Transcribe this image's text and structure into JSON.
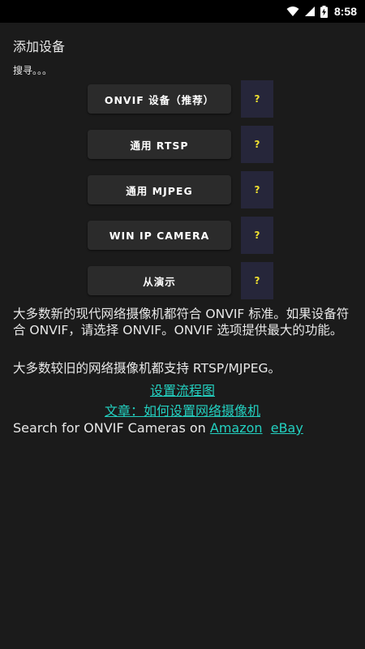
{
  "status_bar": {
    "time": "8:58",
    "icons": [
      "wifi-icon",
      "signal-icon",
      "battery-charging-icon"
    ]
  },
  "header": {
    "title": "添加设备",
    "status_text": "搜寻。。。"
  },
  "options": [
    {
      "label": "ONVIF 设备（推荐）",
      "help": "?"
    },
    {
      "label": "通用 RTSP",
      "help": "?"
    },
    {
      "label": "通用 MJPEG",
      "help": "?"
    },
    {
      "label": "WIN IP CAMERA",
      "help": "?"
    },
    {
      "label": "从演示",
      "help": "?"
    }
  ],
  "info": {
    "onvif_text": "大多数新的现代网络摄像机都符合 ONVIF 标准。如果设备符合 ONVIF，请选择 ONVIF。ONVIF 选项提供最大的功能。",
    "legacy_text": "大多数较旧的网络摄像机都支持 RTSP/MJPEG。"
  },
  "links": {
    "setup_flowchart": "设置流程图",
    "article": "文章：如何设置网络摄像机",
    "search_prefix": "Search for ONVIF Cameras on ",
    "amazon": "Amazon",
    "ebay": "eBay"
  },
  "colors": {
    "background": "#1b1b1b",
    "button": "#2b2b2b",
    "help_button": "#26263a",
    "help_text": "#f0e030",
    "link": "#23d0c0"
  }
}
